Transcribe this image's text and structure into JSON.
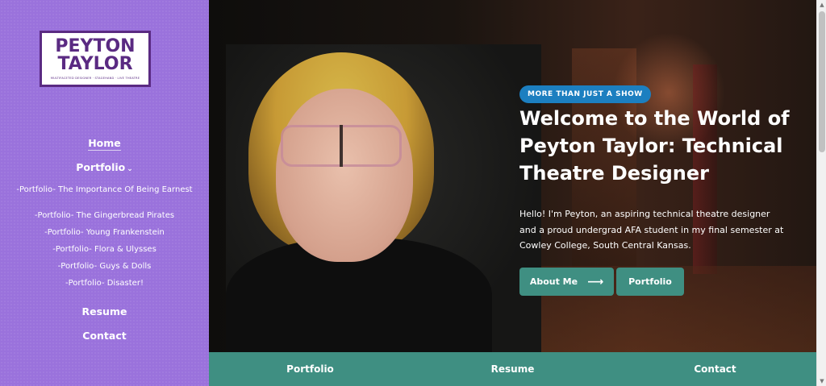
{
  "logo": {
    "line1": "PEYTON",
    "line2": "TAYLOR",
    "tagline": "MULTIFACETED DESIGNER · STAGEHAND · LIVE THEATRE"
  },
  "sidebar": {
    "home": "Home",
    "portfolio": "Portfolio",
    "portfolio_items": [
      "-Portfolio- The Importance Of Being Earnest",
      "-Portfolio- The Gingerbread Pirates",
      "-Portfolio- Young Frankenstein",
      "-Portfolio- Flora & Ulysses",
      "-Portfolio- Guys & Dolls",
      "-Portfolio- Disaster!"
    ],
    "resume": "Resume",
    "contact": "Contact"
  },
  "hero": {
    "badge": "MORE THAN JUST A SHOW",
    "title": "Welcome to the World of Peyton Taylor: Technical Theatre Designer",
    "text": "Hello! I'm Peyton, an aspiring technical theatre designer and a proud undergrad AFA student in my final semester at Cowley College, South Central Kansas.",
    "about_button": "About Me",
    "portfolio_button": "Portfolio"
  },
  "bottom_bar": {
    "portfolio": "Portfolio",
    "resume": "Resume",
    "contact": "Contact"
  },
  "colors": {
    "sidebar": "#9a72dc",
    "logo_purple": "#5a2a82",
    "accent_teal": "#3f8f82",
    "badge_blue": "#1c7fc0"
  }
}
